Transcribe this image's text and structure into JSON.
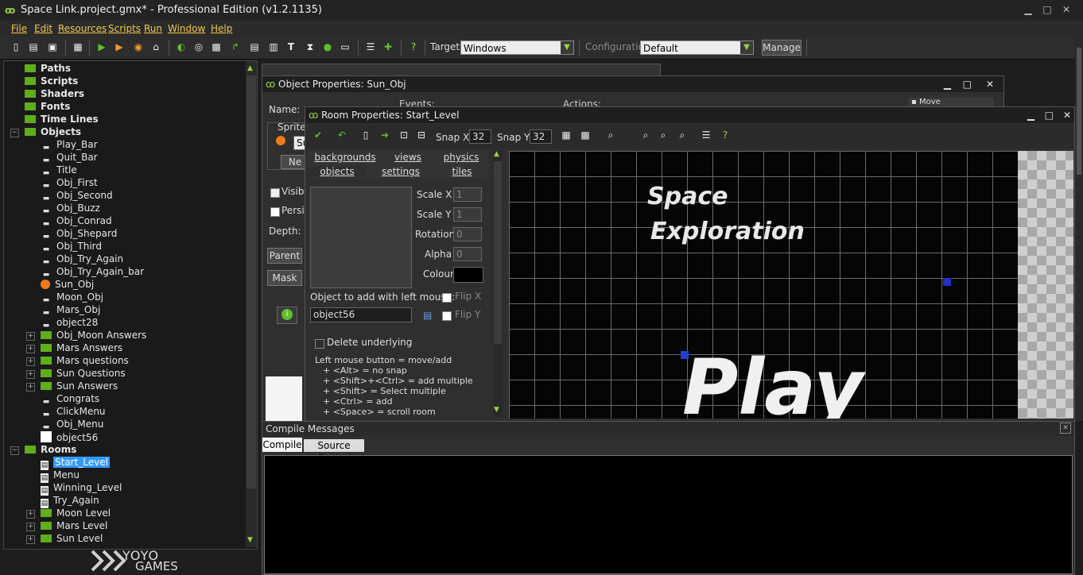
{
  "app": {
    "title": "Space Link.project.gmx*  -  Professional Edition (v1.2.1135)"
  },
  "menu": [
    "File",
    "Edit",
    "Resources",
    "Scripts",
    "Run",
    "Window",
    "Help"
  ],
  "toolbar": {
    "target_label": "Target:",
    "target_value": "Windows",
    "config_label": "Configuration:",
    "config_value": "Default",
    "manage_label": "Manage"
  },
  "tree": {
    "items": [
      {
        "label": "Paths",
        "type": "folder",
        "bold": true
      },
      {
        "label": "Scripts",
        "type": "folder",
        "bold": true
      },
      {
        "label": "Shaders",
        "type": "folder",
        "bold": true
      },
      {
        "label": "Fonts",
        "type": "folder",
        "bold": true
      },
      {
        "label": "Time Lines",
        "type": "folder",
        "bold": true
      },
      {
        "label": "Objects",
        "type": "folder",
        "bold": true
      },
      {
        "label": "Play_Bar",
        "type": "object"
      },
      {
        "label": "Quit_Bar",
        "type": "object"
      },
      {
        "label": "Title",
        "type": "object"
      },
      {
        "label": "Obj_First",
        "type": "object"
      },
      {
        "label": "Obj_Second",
        "type": "object"
      },
      {
        "label": "Obj_Buzz",
        "type": "object"
      },
      {
        "label": "Obj_Conrad",
        "type": "object"
      },
      {
        "label": "Obj_Shepard",
        "type": "object"
      },
      {
        "label": "Obj_Third",
        "type": "object"
      },
      {
        "label": "Obj_Try_Again",
        "type": "object"
      },
      {
        "label": "Obj_Try_Again_bar",
        "type": "object"
      },
      {
        "label": "Sun_Obj",
        "type": "sun"
      },
      {
        "label": "Moon_Obj",
        "type": "object"
      },
      {
        "label": "Mars_Obj",
        "type": "object"
      },
      {
        "label": "object28",
        "type": "object"
      },
      {
        "label": "Obj_Moon Answers",
        "type": "subfolder"
      },
      {
        "label": "Mars Answers",
        "type": "subfolder"
      },
      {
        "label": "Mars questions",
        "type": "subfolder"
      },
      {
        "label": "Sun Questions",
        "type": "subfolder"
      },
      {
        "label": "Sun Answers",
        "type": "subfolder"
      },
      {
        "label": "Congrats",
        "type": "object"
      },
      {
        "label": "ClickMenu",
        "type": "object"
      },
      {
        "label": "Obj_Menu",
        "type": "object"
      },
      {
        "label": "object56",
        "type": "blank"
      },
      {
        "label": "Rooms",
        "type": "folder",
        "bold": true
      },
      {
        "label": "Start_Level",
        "type": "room",
        "selected": true
      },
      {
        "label": "Menu",
        "type": "room"
      },
      {
        "label": "Winning_Level",
        "type": "room"
      },
      {
        "label": "Try_Again",
        "type": "room"
      },
      {
        "label": "Moon Level",
        "type": "subfolder"
      },
      {
        "label": "Mars Level",
        "type": "subfolder"
      },
      {
        "label": "Sun Level",
        "type": "subfolder"
      }
    ]
  },
  "logo": {
    "yoyo": "YOYO",
    "games": "GAMES"
  },
  "object_window": {
    "title": "Object Properties: Sun_Obj",
    "name_label": "Name:",
    "sprite_label": "Sprite",
    "sprite_value": "Su",
    "new_label": "Ne",
    "visible_label": "Visible",
    "persist_label": "Persis",
    "depth_label": "Depth:",
    "parent_label": "Parent",
    "mask_label": "Mask",
    "events_label": "Events:",
    "actions_label": "Actions:",
    "move_label": "Move"
  },
  "room_window": {
    "title": "Room Properties: Start_Level",
    "snap_x_label": "Snap X:",
    "snap_x": "32",
    "snap_y_label": "Snap Y:",
    "snap_y": "32",
    "tabs_row1": [
      "backgrounds",
      "views",
      "physics"
    ],
    "tabs_row2": [
      "objects",
      "settings",
      "tiles"
    ],
    "scale_x_label": "Scale X",
    "scale_x": "1",
    "scale_y_label": "Scale Y",
    "scale_y": "1",
    "rotation_label": "Rotation",
    "rotation": "0",
    "alpha_label": "Alpha",
    "alpha": "0",
    "colour_label": "Colour",
    "add_label": "Object to add with left mouse:",
    "flip_x": "Flip X",
    "flip_y": "Flip Y",
    "object_value": "object56",
    "delete_underlying": "Delete underlying",
    "help_lines": [
      "Left mouse button = move/add",
      "+ <Alt> = no snap",
      "+ <Shift>+<Ctrl> = add multiple",
      "+ <Shift> = Select multiple",
      "+ <Ctrl> = add",
      "+ <Space> = scroll room"
    ],
    "canvas_text": {
      "space": "Space",
      "exploration": "Exploration",
      "play": "Play"
    }
  },
  "compile": {
    "title": "Compile Messages",
    "tabs": [
      "Compile",
      "Source Control"
    ]
  },
  "colors": {
    "accent": "#9ad23a",
    "menu": "#f2c64a",
    "selected": "#3399ff"
  }
}
